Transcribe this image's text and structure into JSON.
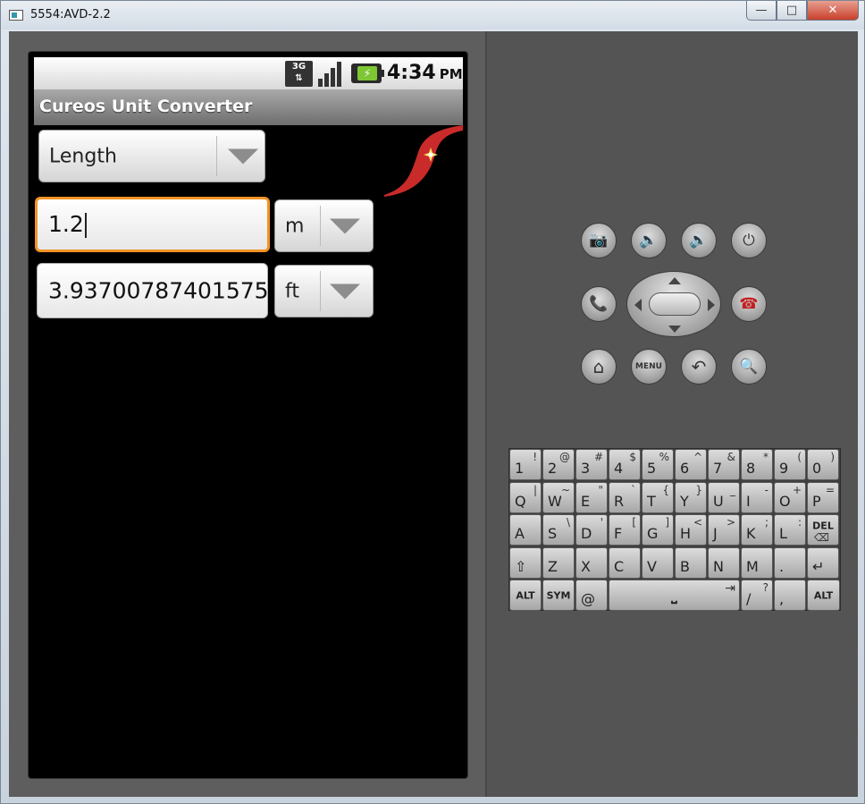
{
  "window": {
    "title": "5554:AVD-2.2",
    "minimize": "—",
    "maximize": "□",
    "close": "✕"
  },
  "statusbar": {
    "network": "3G",
    "time": "4:34",
    "ampm": "PM"
  },
  "app": {
    "title": "Cureos Unit Converter",
    "category": "Length",
    "input_value": "1.2",
    "input_unit": "m",
    "output_value": "3.93700787401575",
    "output_unit": "ft"
  },
  "hardware_buttons": {
    "camera": "📷",
    "volume_down": "🔈",
    "volume_up": "🔊",
    "power": "⏻",
    "call": "📞",
    "end_call": "☎",
    "home": "⌂",
    "menu": "MENU",
    "back": "↶",
    "search": "🔍"
  },
  "keyboard": {
    "row1": [
      {
        "m": "1",
        "s": "!"
      },
      {
        "m": "2",
        "s": "@"
      },
      {
        "m": "3",
        "s": "#"
      },
      {
        "m": "4",
        "s": "$"
      },
      {
        "m": "5",
        "s": "%"
      },
      {
        "m": "6",
        "s": "^"
      },
      {
        "m": "7",
        "s": "&"
      },
      {
        "m": "8",
        "s": "*"
      },
      {
        "m": "9",
        "s": "("
      },
      {
        "m": "0",
        "s": ")"
      }
    ],
    "row2": [
      {
        "m": "Q",
        "s": "|"
      },
      {
        "m": "W",
        "s": "~"
      },
      {
        "m": "E",
        "s": "\""
      },
      {
        "m": "R",
        "s": "`"
      },
      {
        "m": "T",
        "s": "{"
      },
      {
        "m": "Y",
        "s": "}"
      },
      {
        "m": "U",
        "s": "_"
      },
      {
        "m": "I",
        "s": "-"
      },
      {
        "m": "O",
        "s": "+"
      },
      {
        "m": "P",
        "s": "="
      }
    ],
    "row3": [
      {
        "m": "A",
        "s": ""
      },
      {
        "m": "S",
        "s": "\\"
      },
      {
        "m": "D",
        "s": "'"
      },
      {
        "m": "F",
        "s": "["
      },
      {
        "m": "G",
        "s": "]"
      },
      {
        "m": "H",
        "s": "<"
      },
      {
        "m": "J",
        "s": ">"
      },
      {
        "m": "K",
        "s": ";"
      },
      {
        "m": "L",
        "s": ":"
      },
      {
        "m": "DEL",
        "s": "⌫"
      }
    ],
    "row4": [
      {
        "m": "⇧",
        "s": ""
      },
      {
        "m": "Z",
        "s": ""
      },
      {
        "m": "X",
        "s": ""
      },
      {
        "m": "C",
        "s": ""
      },
      {
        "m": "V",
        "s": ""
      },
      {
        "m": "B",
        "s": ""
      },
      {
        "m": "N",
        "s": ""
      },
      {
        "m": "M",
        "s": ""
      },
      {
        "m": ".",
        "s": ""
      },
      {
        "m": "↵",
        "s": ""
      }
    ],
    "row5": {
      "alt_left": "ALT",
      "sym": "SYM",
      "at": "@",
      "space": "⎵",
      "tab": "⇥",
      "slash": "/",
      "question": "?",
      "comma": ",",
      "alt_right": "ALT"
    }
  }
}
